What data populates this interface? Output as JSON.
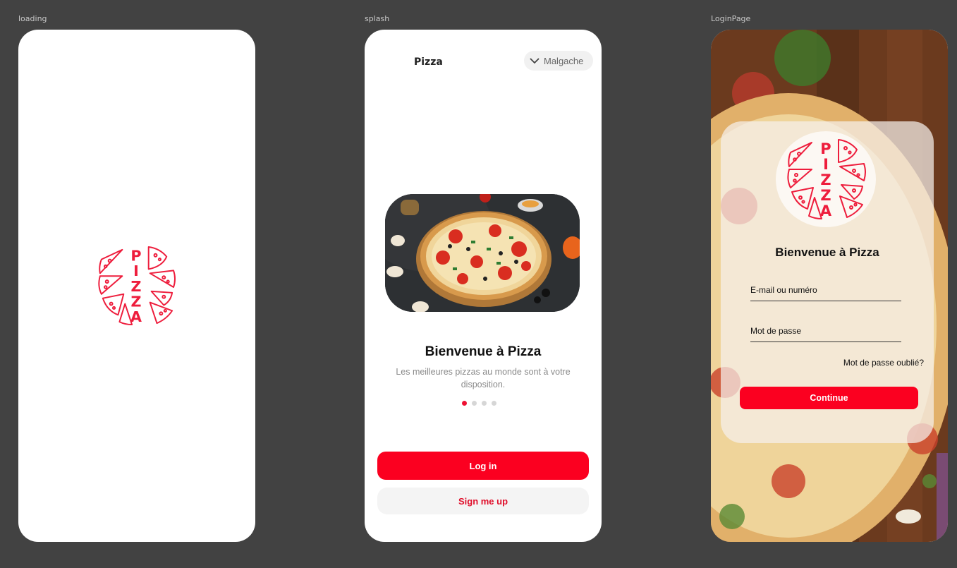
{
  "frames": {
    "loading_label": "loading",
    "splash_label": "splash",
    "login_label": "LoginPage"
  },
  "logo": {
    "letters": [
      "P",
      "I",
      "Z",
      "Z",
      "A"
    ],
    "color": "#ee1d3c"
  },
  "splash": {
    "brand": "Pizza",
    "language": "Malgache",
    "title": "Bienvenue à Pizza",
    "subtitle": "Les meilleures pizzas au monde sont à votre disposition.",
    "dots_total": 4,
    "dots_active": 1,
    "login_button": "Log in",
    "signup_button": "Sign me up"
  },
  "login": {
    "title": "Bienvenue à Pizza",
    "email_placeholder": "E-mail ou numéro",
    "password_placeholder": "Mot de passe",
    "forgot_link": "Mot de passe oublié?",
    "continue_button": "Continue"
  },
  "colors": {
    "accent": "#fb0020",
    "background": "#424242"
  }
}
